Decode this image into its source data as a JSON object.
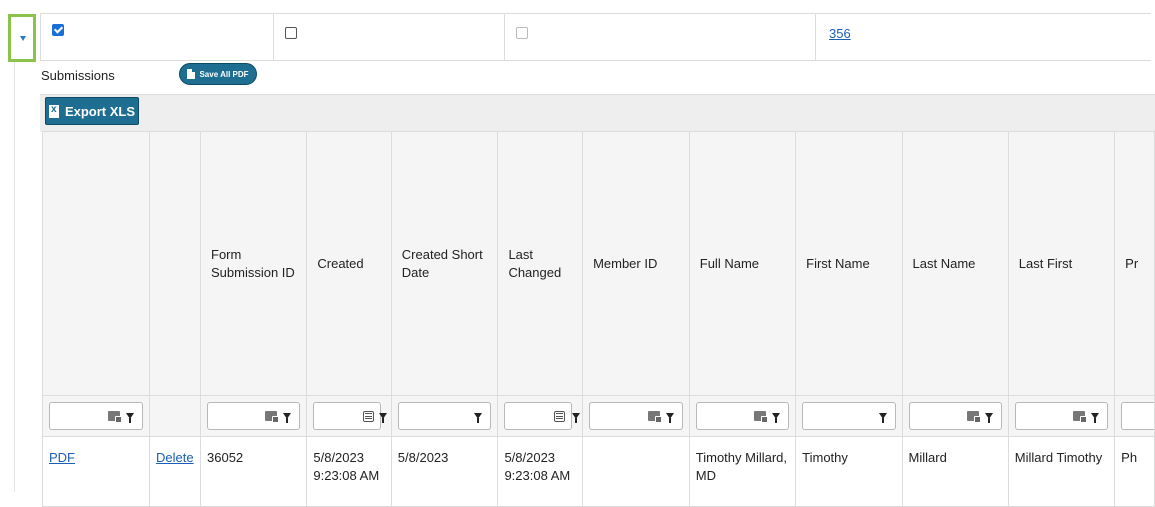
{
  "parent_row": {
    "cb1_checked": true,
    "cb2_checked": false,
    "cb3_disabled": true,
    "link_value": "356"
  },
  "submissions": {
    "label": "Submissions",
    "save_all_pdf_label": "Save All PDF",
    "export_xls_label": "Export XLS"
  },
  "grid": {
    "columns": [
      "",
      "",
      "Form Submission ID",
      "Created",
      "Created Short Date",
      "Last Changed",
      "Member ID",
      "Full Name",
      "First Name",
      "Last Name",
      "Last First",
      "Pr"
    ],
    "rows": [
      {
        "pdf": "PDF",
        "delete": "Delete",
        "form_submission_id": "36052",
        "created": "5/8/2023 9:23:08 AM",
        "created_short_date": "5/8/2023",
        "last_changed": "5/8/2023 9:23:08 AM",
        "member_id": "",
        "full_name": "Timothy Millard, MD",
        "first_name": "Timothy",
        "last_name": "Millard",
        "last_first": "Millard Timothy",
        "partial_next": "Ph"
      }
    ]
  },
  "colors": {
    "accent_button": "#1d6e91",
    "highlight_border": "#8bc34a",
    "link": "#1a5fb4"
  }
}
